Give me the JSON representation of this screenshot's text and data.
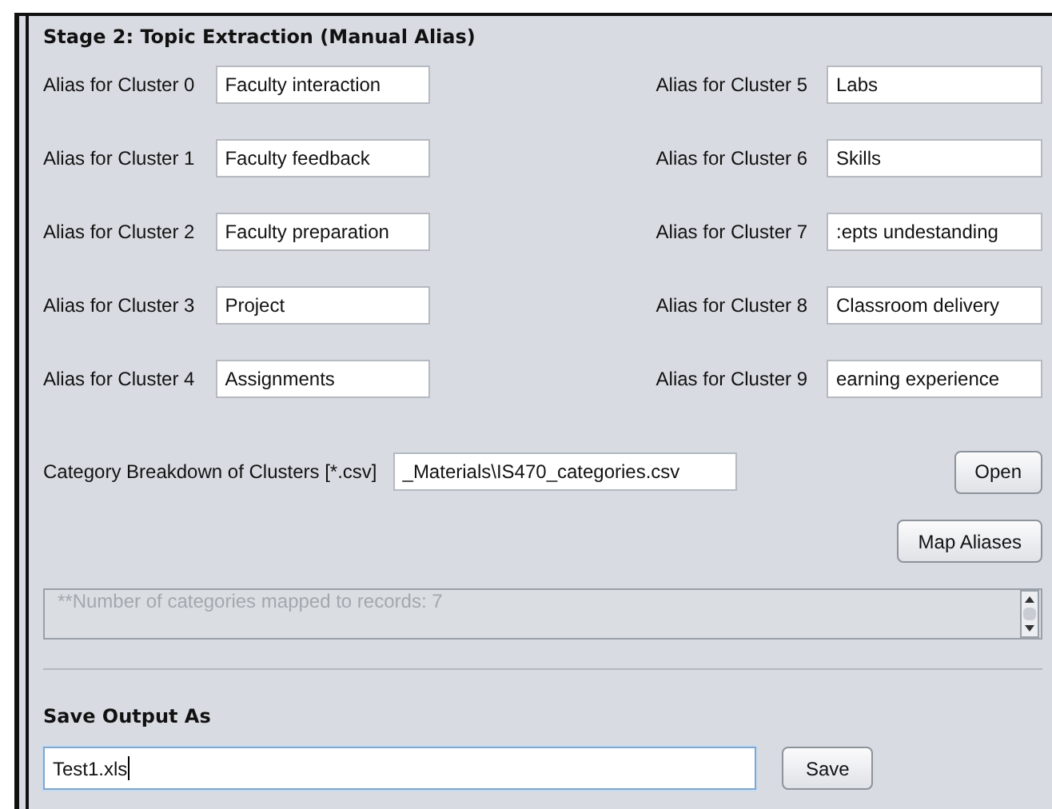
{
  "section_title": "Stage 2: Topic Extraction (Manual Alias)",
  "aliases": [
    {
      "label": "Alias for Cluster 0",
      "value": "Faculty interaction"
    },
    {
      "label": "Alias for Cluster 1",
      "value": "Faculty feedback"
    },
    {
      "label": "Alias for Cluster 2",
      "value": "Faculty preparation"
    },
    {
      "label": "Alias for Cluster 3",
      "value": "Project"
    },
    {
      "label": "Alias for Cluster 4",
      "value": "Assignments"
    },
    {
      "label": "Alias for Cluster 5",
      "value": "Labs"
    },
    {
      "label": "Alias for Cluster 6",
      "value": "Skills"
    },
    {
      "label": "Alias for Cluster 7",
      "value": ":epts undestanding"
    },
    {
      "label": "Alias for Cluster 8",
      "value": "Classroom delivery"
    },
    {
      "label": "Alias for Cluster 9",
      "value": "earning experience"
    }
  ],
  "category": {
    "label": "Category Breakdown of Clusters [*.csv]",
    "value": "_Materials\\IS470_categories.csv",
    "button": "Open"
  },
  "map_button": "Map Aliases",
  "log": {
    "text": "**Number of categories mapped to records: 7",
    "disabled": true
  },
  "save": {
    "title": "Save Output As",
    "value": "Test1.xls",
    "focused": true,
    "button": "Save"
  }
}
